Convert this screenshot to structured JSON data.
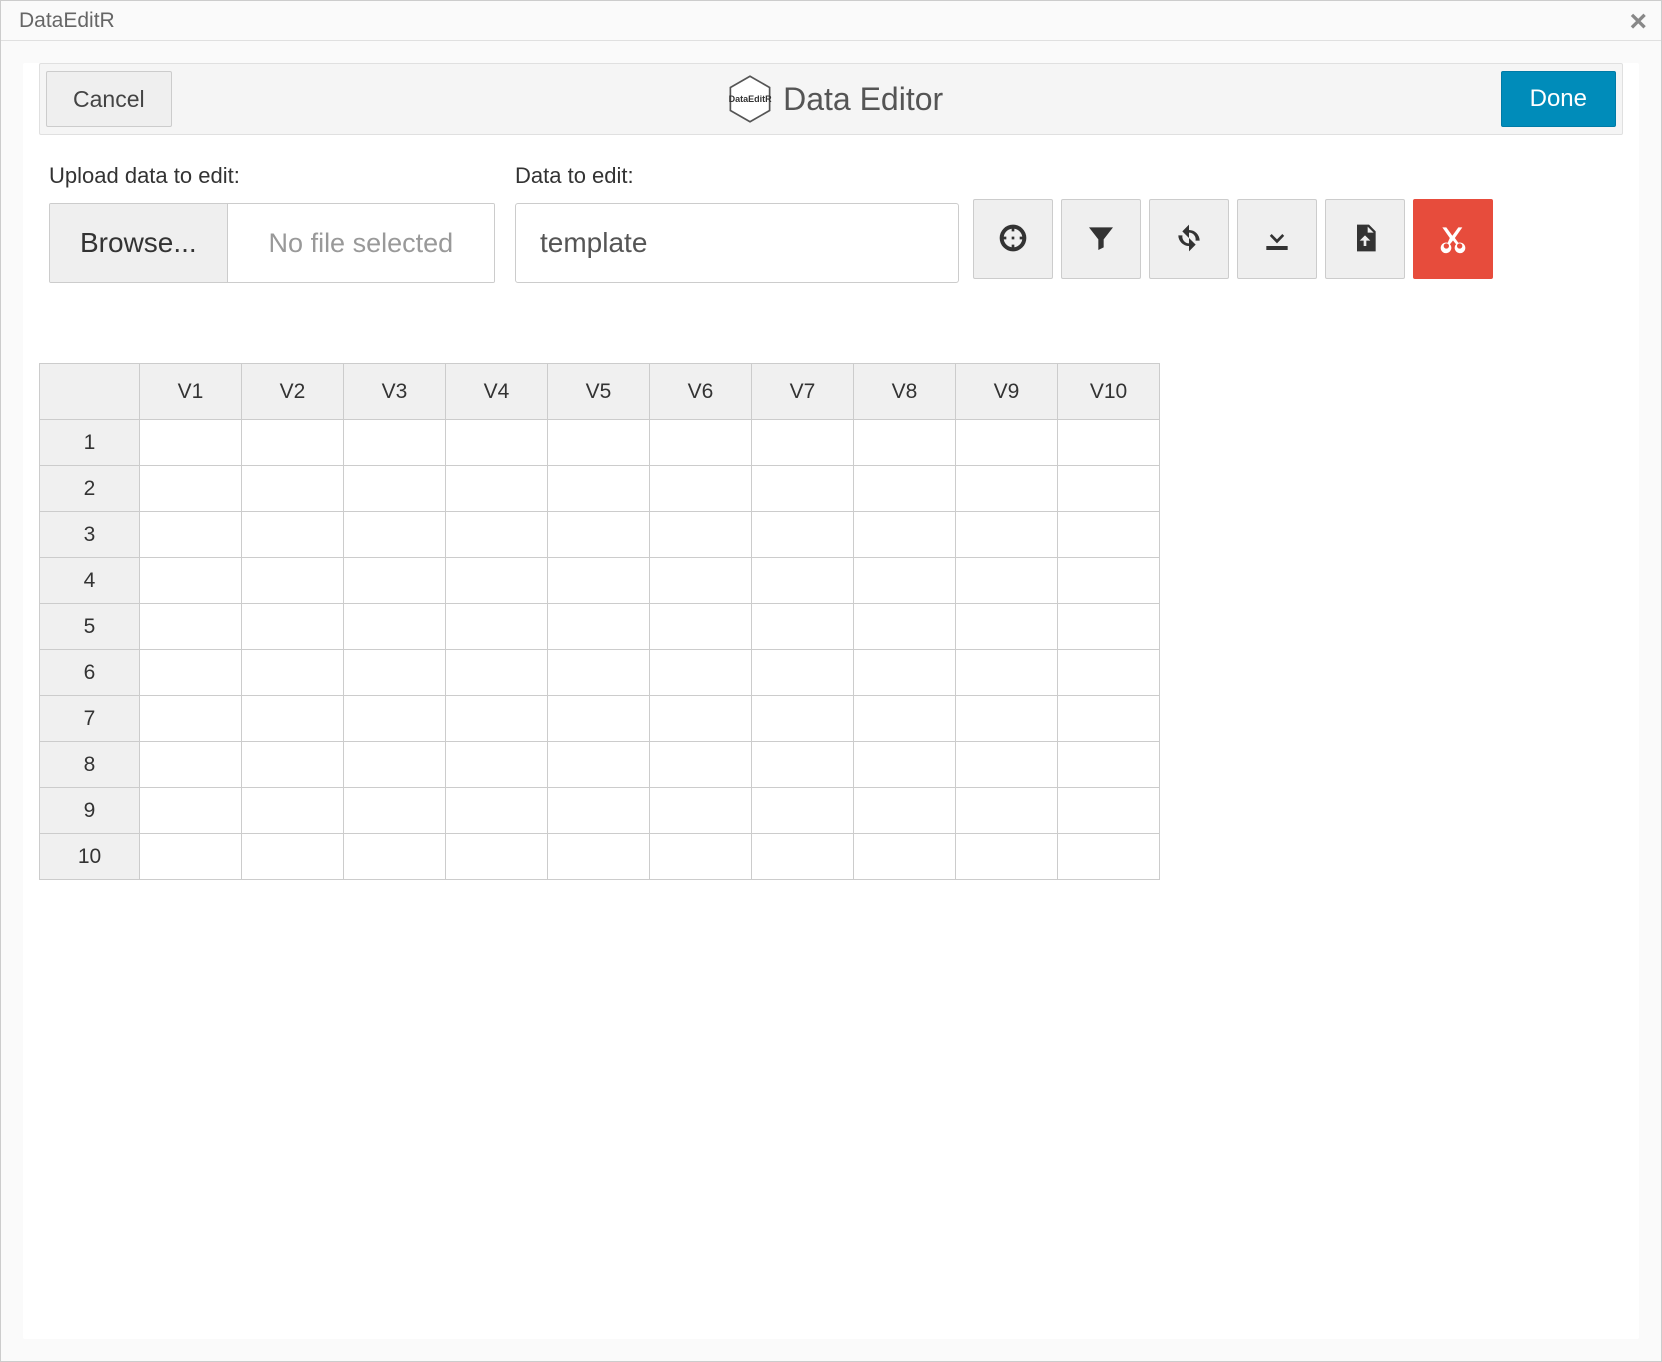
{
  "window": {
    "title": "DataEditR"
  },
  "header": {
    "cancel_label": "Cancel",
    "title": "Data Editor",
    "logo_text": "DataEditR",
    "done_label": "Done"
  },
  "upload": {
    "label": "Upload data to edit:",
    "browse_label": "Browse...",
    "status_text": "No file selected"
  },
  "data_select": {
    "label": "Data to edit:",
    "value": "template"
  },
  "toolbar_icons": {
    "select": "select-columns-icon",
    "filter": "filter-icon",
    "sync": "refresh-icon",
    "download": "download-icon",
    "save": "save-file-icon",
    "cut": "cut-icon"
  },
  "colors": {
    "primary": "#008cba",
    "danger": "#e74c3c",
    "toolbar_bg": "#efefef"
  },
  "grid": {
    "columns": [
      "V1",
      "V2",
      "V3",
      "V4",
      "V5",
      "V6",
      "V7",
      "V8",
      "V9",
      "V10"
    ],
    "row_headers": [
      "1",
      "2",
      "3",
      "4",
      "5",
      "6",
      "7",
      "8",
      "9",
      "10"
    ],
    "rows": [
      [
        "",
        "",
        "",
        "",
        "",
        "",
        "",
        "",
        "",
        ""
      ],
      [
        "",
        "",
        "",
        "",
        "",
        "",
        "",
        "",
        "",
        ""
      ],
      [
        "",
        "",
        "",
        "",
        "",
        "",
        "",
        "",
        "",
        ""
      ],
      [
        "",
        "",
        "",
        "",
        "",
        "",
        "",
        "",
        "",
        ""
      ],
      [
        "",
        "",
        "",
        "",
        "",
        "",
        "",
        "",
        "",
        ""
      ],
      [
        "",
        "",
        "",
        "",
        "",
        "",
        "",
        "",
        "",
        ""
      ],
      [
        "",
        "",
        "",
        "",
        "",
        "",
        "",
        "",
        "",
        ""
      ],
      [
        "",
        "",
        "",
        "",
        "",
        "",
        "",
        "",
        "",
        ""
      ],
      [
        "",
        "",
        "",
        "",
        "",
        "",
        "",
        "",
        "",
        ""
      ],
      [
        "",
        "",
        "",
        "",
        "",
        "",
        "",
        "",
        "",
        ""
      ]
    ]
  }
}
